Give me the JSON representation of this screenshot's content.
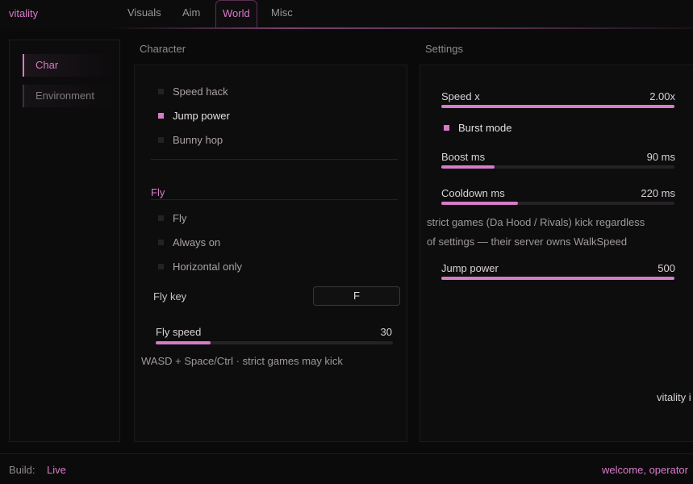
{
  "app": {
    "brand": "vitality"
  },
  "tabs": [
    {
      "label": "Visuals",
      "active": false
    },
    {
      "label": "Aim",
      "active": false
    },
    {
      "label": "World",
      "active": true
    },
    {
      "label": "Misc",
      "active": false
    }
  ],
  "sidebar": {
    "items": [
      {
        "label": "Char",
        "active": true
      },
      {
        "label": "Environment",
        "active": false
      }
    ]
  },
  "character": {
    "title": "Character",
    "toggles": [
      {
        "label": "Speed hack",
        "checked": false
      },
      {
        "label": "Jump power",
        "checked": true
      },
      {
        "label": "Bunny hop",
        "checked": false
      }
    ],
    "fly_section": "Fly",
    "fly_toggles": [
      {
        "label": "Fly",
        "checked": false
      },
      {
        "label": "Always on",
        "checked": false
      },
      {
        "label": "Horizontal only",
        "checked": false
      }
    ],
    "fly_key_label": "Fly key",
    "fly_key_value": "F",
    "fly_speed": {
      "label": "Fly speed",
      "value": "30",
      "fill": 0.23
    },
    "hint": "WASD + Space/Ctrl · strict games may kick"
  },
  "settings": {
    "title": "Settings",
    "speed_x": {
      "label": "Speed x",
      "value": "2.00x",
      "fill": 1.0
    },
    "burst_mode": {
      "label": "Burst mode",
      "checked": true
    },
    "boost_ms": {
      "label": "Boost ms",
      "value": "90 ms",
      "fill": 0.23
    },
    "cooldown_ms": {
      "label": "Cooldown ms",
      "value": "220 ms",
      "fill": 0.33
    },
    "warning_line1": "strict games (Da Hood / Rivals) kick regardless",
    "warning_line2": "of settings — their server owns WalkSpeed",
    "jump_power": {
      "label": "Jump power",
      "value": "500",
      "fill": 1.0
    },
    "overflow_text": "vitality i"
  },
  "status": {
    "build_label": "Build:",
    "build_value": "Live",
    "welcome": "welcome, operator"
  },
  "colors": {
    "accent": "#d77bc8",
    "background": "#0b0a0b"
  }
}
